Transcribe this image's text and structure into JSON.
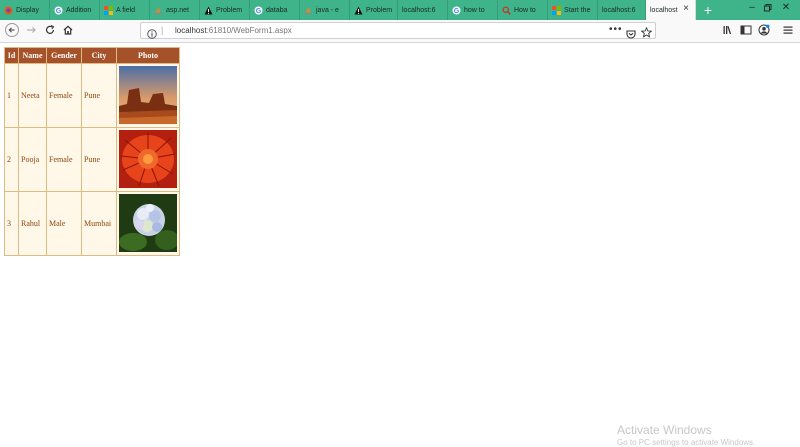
{
  "browser": {
    "tabs": [
      {
        "label": "Display",
        "icon": "firefox-icon"
      },
      {
        "label": "Addition",
        "icon": "google-icon"
      },
      {
        "label": "A field",
        "icon": "microsoft-icon"
      },
      {
        "label": "asp.net",
        "icon": "stackoverflow-icon"
      },
      {
        "label": "Problem",
        "icon": "warning-icon"
      },
      {
        "label": "databa",
        "icon": "google-icon"
      },
      {
        "label": "java - e",
        "icon": "stackoverflow-icon"
      },
      {
        "label": "Problem",
        "icon": "warning-icon"
      },
      {
        "label": "localhost:6",
        "icon": "none"
      },
      {
        "label": "how to",
        "icon": "google-icon"
      },
      {
        "label": "How to",
        "icon": "search-icon"
      },
      {
        "label": "Start the",
        "icon": "microsoft-icon"
      },
      {
        "label": "localhost:6",
        "icon": "none"
      },
      {
        "label": "localhost",
        "icon": "none",
        "active": true
      }
    ],
    "url": {
      "host": "localhost",
      "rest": ":61810/WebForm1.aspx"
    }
  },
  "grid": {
    "headers": [
      "Id",
      "Name",
      "Gender",
      "City",
      "Photo"
    ],
    "rows": [
      {
        "id": "1",
        "name": "Neeta",
        "gender": "Female",
        "city": "Pune",
        "photo": "desert-photo"
      },
      {
        "id": "2",
        "name": "Pooja",
        "gender": "Female",
        "city": "Pune",
        "photo": "chrysanthemum-photo"
      },
      {
        "id": "3",
        "name": "Rahul",
        "gender": "Male",
        "city": "Mumbai",
        "photo": "hydrangea-photo"
      }
    ],
    "colors": {
      "header_bg": "#a55129",
      "row_bg": "#fff7e7",
      "text": "#8c4510",
      "border": "#deba84"
    }
  },
  "watermark": {
    "title": "Activate Windows",
    "subtitle": "Go to PC settings to activate Windows."
  }
}
